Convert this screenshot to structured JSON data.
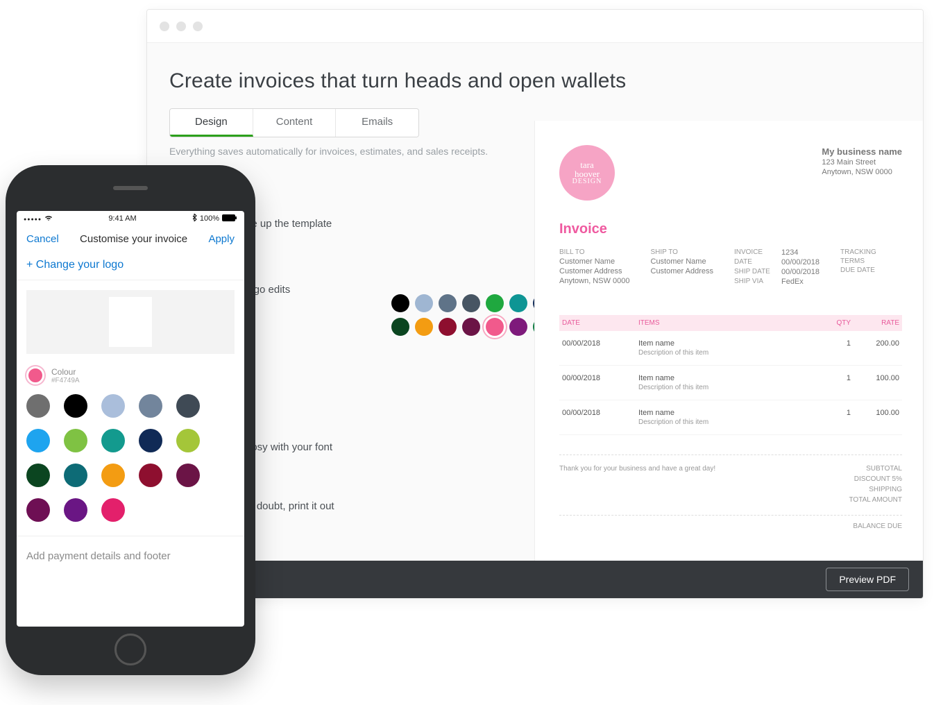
{
  "browser": {
    "heading": "Create invoices that turn heads and open wallets",
    "tabs": {
      "design": "Design",
      "content": "Content",
      "emails": "Emails"
    },
    "helper": "Everything saves automatically for invoices, estimates, and sales receipts.",
    "sections": {
      "template": "ge up the template",
      "logo": "logo edits",
      "font": "oosy with your font",
      "print": "in doubt, print it out"
    },
    "palette_row1": [
      "#000000",
      "#9fb6d2",
      "#5f7388",
      "#475563",
      "#1fa83f",
      "#0e9594",
      "#102a56",
      "#a4c639"
    ],
    "palette_row2": [
      "#0b4520",
      "#f39c12",
      "#8e0f2f",
      "#6b1446",
      "#f15a8c",
      "#7e1a7b",
      "#0c7a40",
      "#e3206b"
    ],
    "palette_selected_index": 12,
    "preview_btn": "Preview PDF"
  },
  "invoice": {
    "logo_lines": [
      "tara",
      "hoover",
      "DESIGN"
    ],
    "business": {
      "name": "My business name",
      "addr1": "123 Main Street",
      "addr2": "Anytown, NSW 0000"
    },
    "title": "Invoice",
    "bill_to": {
      "label": "BILL TO",
      "name": "Customer Name",
      "addr": "Customer Address",
      "city": "Anytown, NSW 0000"
    },
    "ship_to": {
      "label": "SHIP TO",
      "name": "Customer Name",
      "addr": "Customer Address"
    },
    "meta": {
      "invoice_k": "INVOICE",
      "invoice_v": "1234",
      "date_k": "DATE",
      "date_v": "00/00/2018",
      "shipdate_k": "SHIP DATE",
      "shipdate_v": "00/00/2018",
      "shipvia_k": "SHIP VIA",
      "shipvia_v": "FedEx",
      "tracking_k": "TRACKING",
      "terms_k": "TERMS",
      "duedate_k": "DUE DATE"
    },
    "thead": {
      "date": "DATE",
      "items": "ITEMS",
      "qty": "QTY",
      "rate": "RATE"
    },
    "rows": [
      {
        "date": "00/00/2018",
        "name": "Item name",
        "desc": "Description of this item",
        "qty": "1",
        "rate": "200.00"
      },
      {
        "date": "00/00/2018",
        "name": "Item name",
        "desc": "Description of this item",
        "qty": "1",
        "rate": "100.00"
      },
      {
        "date": "00/00/2018",
        "name": "Item name",
        "desc": "Description of this item",
        "qty": "1",
        "rate": "100.00"
      }
    ],
    "thankyou": "Thank you for your business and have a great day!",
    "totals": {
      "subtotal": "SUBTOTAL",
      "discount": "DISCOUNT 5%",
      "shipping": "SHIPPING",
      "total": "TOTAL AMOUNT",
      "balance": "BALANCE DUE"
    }
  },
  "phone": {
    "status": {
      "time": "9:41 AM",
      "battery": "100%"
    },
    "nav": {
      "cancel": "Cancel",
      "title": "Customise your invoice",
      "apply": "Apply"
    },
    "change_logo": "+ Change your logo",
    "colour_label": "Colour",
    "colour_hex": "#F4749A",
    "swatches": [
      "#6f6f6f",
      "#000000",
      "#aabedb",
      "#72859c",
      "#3f4a55",
      "#1ea4ef",
      "#7fc243",
      "#139a8e",
      "#102a56",
      "#a4c639",
      "#0b4520",
      "#0d6b76",
      "#f39c12",
      "#8e0f2f",
      "#6b1446",
      "#6e0f54",
      "#6a1684",
      "#e3206b"
    ],
    "footer": "Add payment details and footer"
  }
}
